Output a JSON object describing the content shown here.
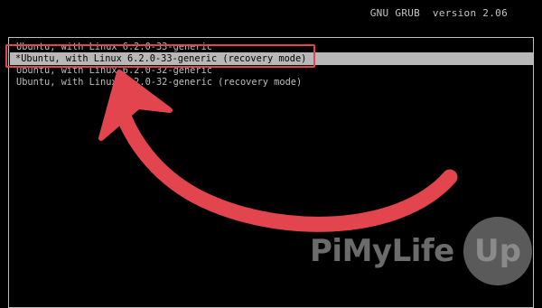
{
  "header": {
    "title": "GNU GRUB  version 2.06"
  },
  "menu": {
    "entries": [
      {
        "label": "Ubuntu, with Linux 6.2.0-33-generic"
      },
      {
        "label": "*Ubuntu, with Linux 6.2.0-33-generic (recovery mode)"
      },
      {
        "label": "Ubuntu, with Linux 6.2.0-32-generic"
      },
      {
        "label": "Ubuntu, with Linux 6.2.0-32-generic (recovery mode)"
      }
    ]
  },
  "annotation": {
    "color": "#e2454e",
    "icon": "curved-arrow-icon"
  },
  "watermark": {
    "brand_text": "PiMyLife",
    "circle_text": "Up"
  }
}
